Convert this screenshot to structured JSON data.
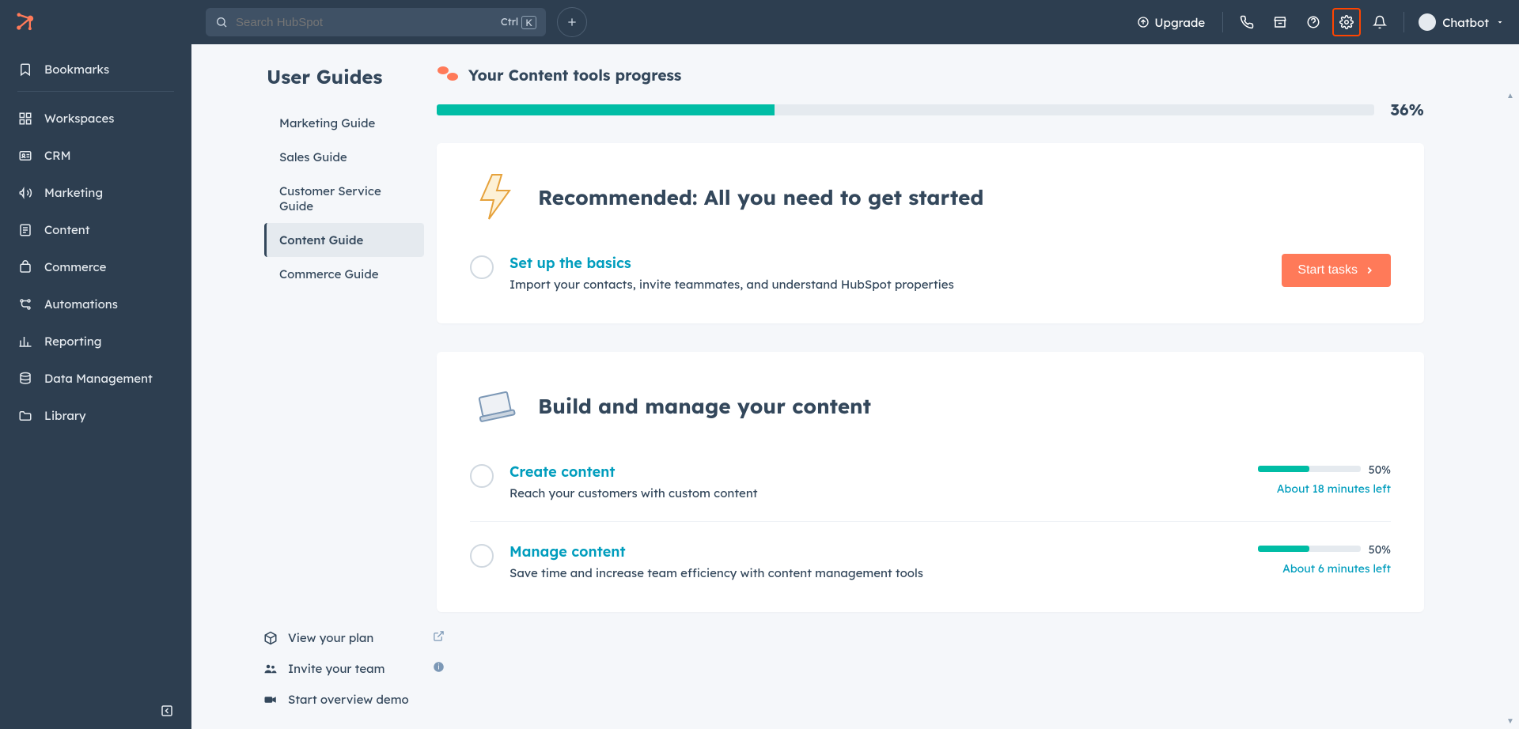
{
  "topbar": {
    "search_placeholder": "Search HubSpot",
    "kbd_ctrl": "Ctrl",
    "kbd_k": "K",
    "upgrade": "Upgrade",
    "user_name": "Chatbot"
  },
  "sidebar": {
    "items": [
      {
        "label": "Bookmarks"
      },
      {
        "label": "Workspaces"
      },
      {
        "label": "CRM"
      },
      {
        "label": "Marketing"
      },
      {
        "label": "Content"
      },
      {
        "label": "Commerce"
      },
      {
        "label": "Automations"
      },
      {
        "label": "Reporting"
      },
      {
        "label": "Data Management"
      },
      {
        "label": "Library"
      }
    ]
  },
  "guides": {
    "title": "User Guides",
    "items": [
      {
        "label": "Marketing Guide"
      },
      {
        "label": "Sales Guide"
      },
      {
        "label": "Customer Service Guide"
      },
      {
        "label": "Content Guide"
      },
      {
        "label": "Commerce Guide"
      }
    ],
    "bottom": {
      "view_plan": "View your plan",
      "invite_team": "Invite your team",
      "overview_demo": "Start overview demo"
    }
  },
  "progress": {
    "title": "Your Content tools progress",
    "percent": 36,
    "percent_label": "36%"
  },
  "cards": [
    {
      "title": "Recommended: All you need to get started",
      "tasks": [
        {
          "title": "Set up the basics",
          "desc": "Import your contacts, invite teammates, and understand HubSpot properties",
          "action": "Start tasks"
        }
      ]
    },
    {
      "title": "Build and manage your content",
      "tasks": [
        {
          "title": "Create content",
          "desc": "Reach your customers with custom content",
          "percent": 50,
          "percent_label": "50%",
          "time_left": "About 18 minutes left"
        },
        {
          "title": "Manage content",
          "desc": "Save time and increase team efficiency with content management tools",
          "percent": 50,
          "percent_label": "50%",
          "time_left": "About 6 minutes left"
        }
      ]
    }
  ]
}
